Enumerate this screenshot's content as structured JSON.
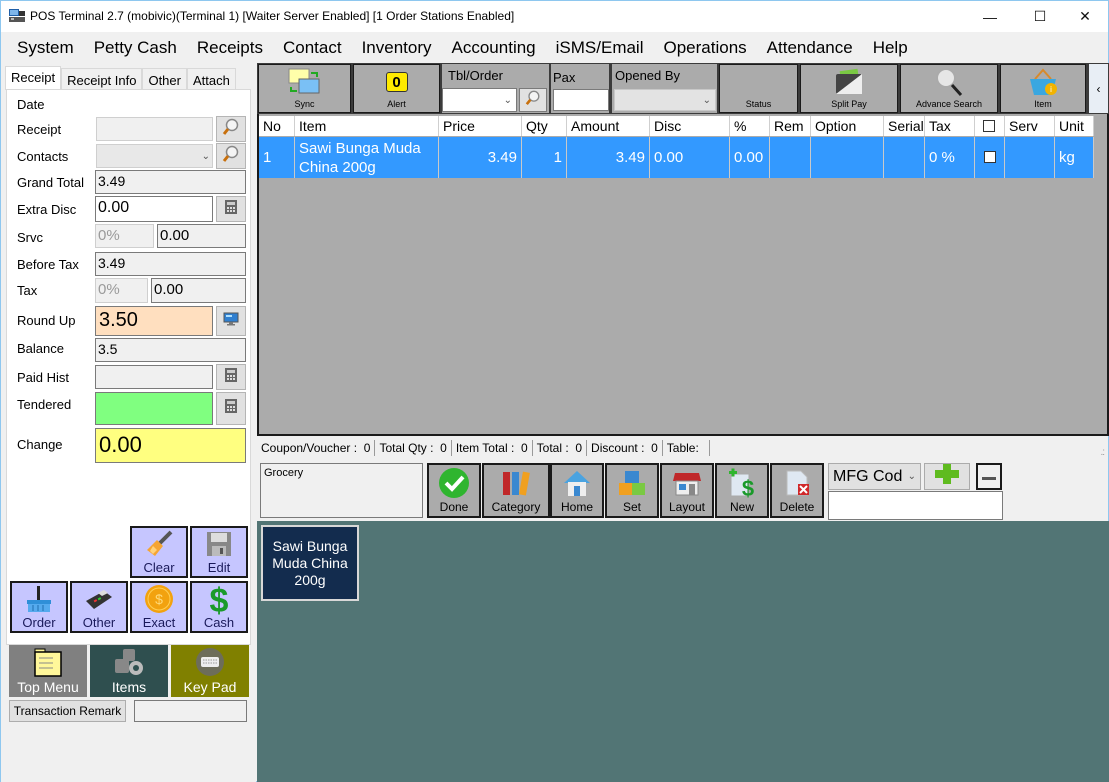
{
  "window": {
    "title": "POS Terminal 2.7 (mobivic)(Terminal 1) [Waiter Server Enabled] [1 Order Stations Enabled]",
    "controls": {
      "minimize": "—",
      "maximize": "☐",
      "close": "✕"
    }
  },
  "menu": [
    "System",
    "Petty Cash",
    "Receipts",
    "Contact",
    "Inventory",
    "Accounting",
    "iSMS/Email",
    "Operations",
    "Attendance",
    "Help"
  ],
  "left_panel": {
    "tabs": [
      "Receipt",
      "Receipt Info",
      "Other",
      "Attach"
    ],
    "active_tab": "Receipt",
    "fields": {
      "date": {
        "label": "Date"
      },
      "receipt": {
        "label": "Receipt",
        "value": ""
      },
      "contacts": {
        "label": "Contacts",
        "value": ""
      },
      "grand_total": {
        "label": "Grand Total",
        "value": "3.49"
      },
      "extra_disc": {
        "label": "Extra Disc",
        "value": "0.00"
      },
      "srvc": {
        "label": "Srvc",
        "percent": "0%",
        "value": "0.00"
      },
      "before_tax": {
        "label": "Before Tax",
        "value": "3.49"
      },
      "tax": {
        "label": "Tax",
        "percent": "0%",
        "value": "0.00"
      },
      "round_up": {
        "label": "Round Up",
        "value": "3.50"
      },
      "balance": {
        "label": "Balance",
        "value": "3.5"
      },
      "paid_hist": {
        "label": "Paid Hist",
        "value": ""
      },
      "tendered": {
        "label": "Tendered",
        "value": ""
      },
      "change": {
        "label": "Change",
        "value": "0.00"
      }
    },
    "pay_buttons": {
      "clear": "Clear",
      "edit": "Edit",
      "order": "Order",
      "other": "Other",
      "exact": "Exact",
      "cash": "Cash"
    },
    "nav_buttons": {
      "top_menu": "Top Menu",
      "items": "Items",
      "key_pad": "Key Pad"
    },
    "transaction_remark": {
      "label": "Transaction Remark",
      "value": ""
    }
  },
  "toolbar": {
    "sync": "Sync",
    "alert": {
      "label": "Alert",
      "count": "0"
    },
    "tbl_order": {
      "label": "Tbl/Order",
      "value": ""
    },
    "pax": {
      "label": "Pax",
      "value": ""
    },
    "opened_by": {
      "label": "Opened By",
      "value": ""
    },
    "status": "Status",
    "split_pay": "Split Pay",
    "advance_search": "Advance Search",
    "item": "Item",
    "collapse": "‹"
  },
  "grid": {
    "columns": [
      "No",
      "Item",
      "Price",
      "Qty",
      "Amount",
      "Disc",
      "%",
      "Rem",
      "Option",
      "Serial",
      "Tax",
      "",
      "Serv",
      "Unit"
    ],
    "rows": [
      {
        "no": "1",
        "item": "Sawi Bunga Muda China 200g",
        "price": "3.49",
        "qty": "1",
        "amount": "3.49",
        "disc": "0.00",
        "pct": "0.00",
        "rem": "",
        "option": "",
        "serial": "",
        "tax": "0 %",
        "checked": false,
        "serv": "",
        "unit": "kg"
      }
    ]
  },
  "summary": [
    {
      "label": "Coupon/Voucher :",
      "value": "0"
    },
    {
      "label": "Total Qty :",
      "value": "0"
    },
    {
      "label": "Item Total :",
      "value": "0"
    },
    {
      "label": "Total :",
      "value": "0"
    },
    {
      "label": "Discount :",
      "value": "0"
    },
    {
      "label": "Table:",
      "value": ""
    }
  ],
  "category": {
    "current": "Grocery",
    "buttons": [
      "Done",
      "Category",
      "Home",
      "Set",
      "Layout",
      "New",
      "Delete"
    ],
    "search_mode": "MFG Cod",
    "search_value": ""
  },
  "items": [
    {
      "name": "Sawi Bunga Muda China 200g"
    }
  ],
  "colors": {
    "selected_row": "#3399ff",
    "round_up_bg": "#ffdfbf",
    "tendered_bg": "#80ff80",
    "change_bg": "#ffff80",
    "pay_button_bg": "#c6c6ff",
    "item_area_bg": "#527575",
    "item_tile_bg": "#132c4e"
  }
}
